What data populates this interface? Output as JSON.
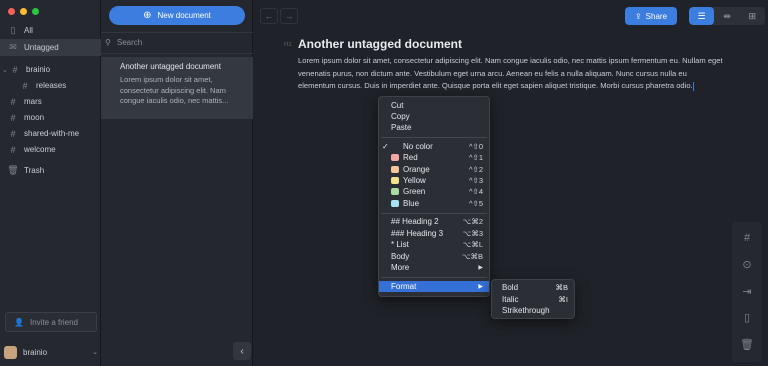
{
  "window": {
    "traffic_colors": [
      "#ff5f57",
      "#febc2e",
      "#28c840"
    ]
  },
  "sidebar": {
    "items": [
      {
        "label": "All",
        "icon": "document-icon"
      },
      {
        "label": "Untagged",
        "icon": "inbox-icon"
      },
      {
        "label": "brainio",
        "icon": "hash-icon"
      },
      {
        "label": "releases",
        "icon": "hash-icon"
      },
      {
        "label": "mars",
        "icon": "hash-icon"
      },
      {
        "label": "moon",
        "icon": "hash-icon"
      },
      {
        "label": "shared-with-me",
        "icon": "hash-icon"
      },
      {
        "label": "welcome",
        "icon": "hash-icon"
      },
      {
        "label": "Trash",
        "icon": "trash-icon"
      }
    ],
    "invite_label": "Invite a friend",
    "user_name": "brainio"
  },
  "list": {
    "new_document_label": "New document",
    "search_placeholder": "Search",
    "note": {
      "title": "Another untagged document",
      "preview": "Lorem ipsum dolor sit amet, consectetur adipiscing elit. Nam congue iaculis odio, nec mattis..."
    }
  },
  "editor": {
    "share_label": "Share",
    "heading_tag": "H1",
    "title": "Another untagged document",
    "body": "Lorem ipsum dolor sit amet, consectetur adipiscing elit. Nam congue iaculis odio, nec mattis ipsum fermentum eu. Nullam eget venenatis purus, non dictum ante. Vestibulum eget urna arcu. Aenean eu felis a nulla aliquam. Nunc cursus nulla eu elementum cursus. Duis in imperdiet ante. Quisque porta elit eget sapien aliquet tristique. Morbi cursus pharetra odio."
  },
  "context_menu": {
    "cut": "Cut",
    "copy": "Copy",
    "paste": "Paste",
    "colors": [
      {
        "label": "No color",
        "shortcut": "^⇧0",
        "checked": true,
        "swatch": ""
      },
      {
        "label": "Red",
        "shortcut": "^⇧1",
        "swatch": "#f4a6a6"
      },
      {
        "label": "Orange",
        "shortcut": "^⇧2",
        "swatch": "#f8c49a"
      },
      {
        "label": "Yellow",
        "shortcut": "^⇧3",
        "swatch": "#f3e08c"
      },
      {
        "label": "Green",
        "shortcut": "^⇧4",
        "swatch": "#a9dca0"
      },
      {
        "label": "Blue",
        "shortcut": "^⇧5",
        "swatch": "#a6e3f2"
      }
    ],
    "h2": "## Heading 2",
    "h2_sc": "⌥⌘2",
    "h3": "### Heading 3",
    "h3_sc": "⌥⌘3",
    "list": "* List",
    "list_sc": "⌥⌘L",
    "body": "Body",
    "body_sc": "⌥⌘B",
    "more": "More",
    "more_arrow": "▶",
    "format": "Format",
    "format_arrow": "▶"
  },
  "format_submenu": {
    "bold": "Bold",
    "bold_sc": "⌘B",
    "italic": "Italic",
    "italic_sc": "⌘I",
    "strike": "Strikethrough"
  }
}
